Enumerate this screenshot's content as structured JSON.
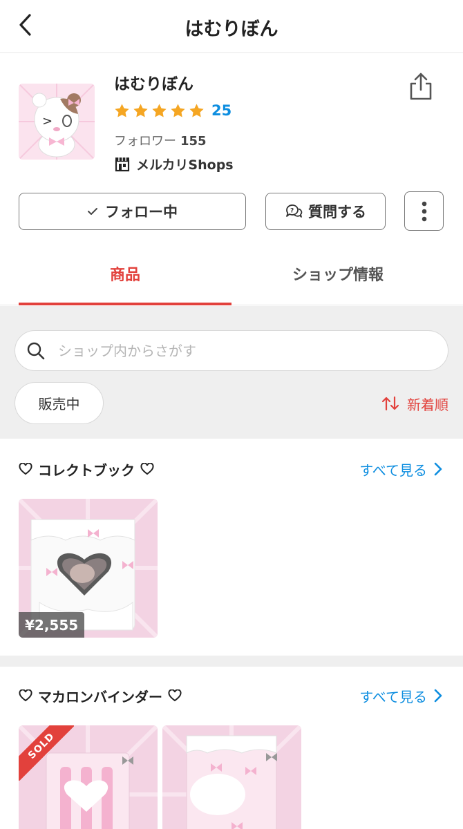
{
  "header": {
    "title": "はむりぼん",
    "back_icon": "chevron-left-icon"
  },
  "profile": {
    "name": "はむりぼん",
    "rating_stars": 5,
    "rating_count": "25",
    "followers_label": "フォロワー",
    "followers_count": "155",
    "shops_label": "メルカリShops",
    "share_icon": "share-icon",
    "avatar": "shop-avatar-bear-illustration"
  },
  "actions": {
    "follow_label": "フォロー中",
    "question_label": "質問する",
    "more_icon": "more-vertical-icon"
  },
  "tabs": [
    {
      "label": "商品",
      "active": true
    },
    {
      "label": "ショップ情報",
      "active": false
    }
  ],
  "filter": {
    "search_placeholder": "ショップ内からさがす",
    "status_label": "販売中",
    "sort_label": "新着順"
  },
  "sections": [
    {
      "title": "コレクトブック",
      "see_all": "すべて見る",
      "items": [
        {
          "price": "¥2,555",
          "sold": false
        }
      ]
    },
    {
      "title": "マカロンバインダー",
      "see_all": "すべて見る",
      "items": [
        {
          "sold": true,
          "sold_label": "SOLD"
        },
        {
          "sold": false
        }
      ]
    }
  ],
  "colors": {
    "accent_red": "#e2413c",
    "link_blue": "#0e8ee0",
    "star_gold": "#f5a623",
    "panel_gray": "#efefef"
  }
}
